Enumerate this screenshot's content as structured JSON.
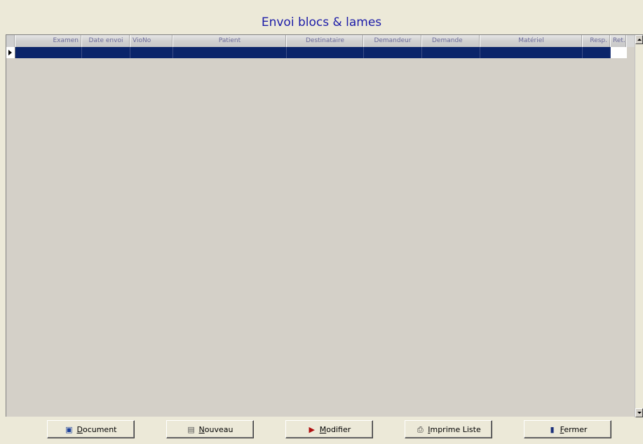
{
  "window": {
    "title": "Envoi blocs & lames"
  },
  "grid": {
    "columns": [
      {
        "label": "Examen",
        "width": 107,
        "align": "right"
      },
      {
        "label": "Date envoi",
        "width": 69,
        "align": "center"
      },
      {
        "label": "VioNo",
        "width": 61,
        "align": "left"
      },
      {
        "label": "Patient",
        "width": 162,
        "align": "center"
      },
      {
        "label": "Destinataire",
        "width": 110,
        "align": "center"
      },
      {
        "label": "Demandeur",
        "width": 83,
        "align": "center"
      },
      {
        "label": "Demande",
        "width": 83,
        "align": "left"
      },
      {
        "label": "Matériel",
        "width": 146,
        "align": "center"
      },
      {
        "label": "Resp.",
        "width": 40,
        "align": "right"
      },
      {
        "label": "Ret.",
        "width": 23,
        "align": "left"
      }
    ],
    "selected_row_color": "#0a246a"
  },
  "buttons": {
    "document": {
      "label": "Document",
      "icon": "word-document-icon"
    },
    "nouveau": {
      "label": "Nouveau",
      "icon": "new-document-icon"
    },
    "modifier": {
      "label": "Modifier",
      "icon": "edit-document-icon"
    },
    "imprime": {
      "label": "Imprime Liste",
      "icon": "printer-icon"
    },
    "fermer": {
      "label": "Fermer",
      "icon": "exit-door-icon"
    }
  }
}
